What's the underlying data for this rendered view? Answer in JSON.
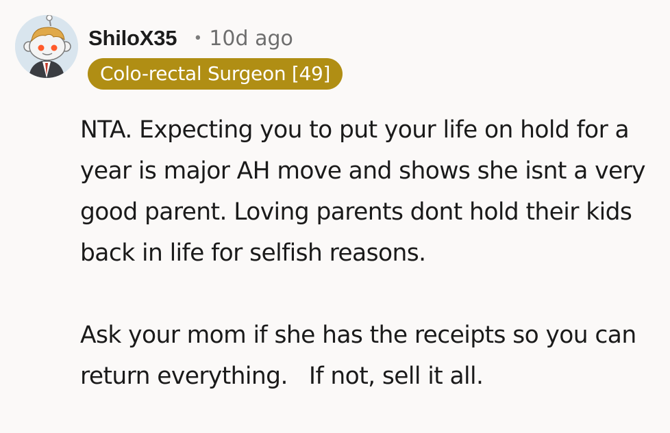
{
  "comment": {
    "author": "ShiloX35",
    "separator": "•",
    "timestamp": "10d ago",
    "flair": "Colo-rectal Surgeon [49]",
    "paragraphs": [
      "NTA. Expecting you to put your life on hold for a year is major AH move and shows she isnt a very good parent. Loving parents dont hold their kids back in life for selfish reasons.",
      "Ask your mom if she has the receipts so you can return everything.   If not, sell it all."
    ]
  },
  "colors": {
    "background": "#fbf9f8",
    "flair_background": "#b08e14",
    "flair_text": "#ffffff",
    "author_text": "#1c1c1c",
    "meta_text": "#6e6e6e"
  },
  "icons": {
    "avatar": "snoo-avatar-icon"
  }
}
